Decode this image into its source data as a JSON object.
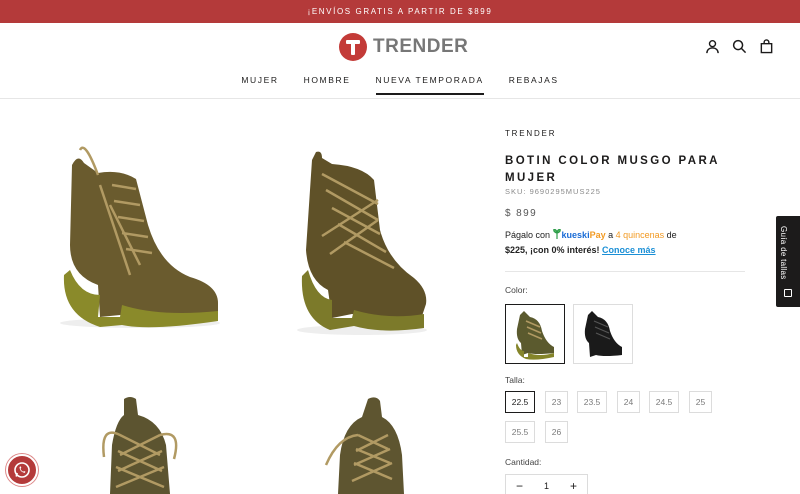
{
  "announcement": "¡ENVÍOS GRATIS A PARTIR DE $899",
  "brand_logo": {
    "text": "TRENDER",
    "color": "#c33b38"
  },
  "header_icons": [
    "account-icon",
    "search-icon",
    "cart-icon"
  ],
  "nav": {
    "items": [
      {
        "label": "MUJER"
      },
      {
        "label": "HOMBRE"
      },
      {
        "label": "NUEVA TEMPORADA"
      },
      {
        "label": "REBAJAS"
      }
    ],
    "active": "NUEVA TEMPORADA"
  },
  "product": {
    "brand": "TRENDER",
    "title": "BOTIN COLOR MUSGO PARA MUJER",
    "sku": "SKU: 9690295MUS225",
    "price": "$ 899",
    "kueski": {
      "prefix": "Págalo con ",
      "logo_a": "kueski",
      "logo_b": "Pay",
      "mid": " a ",
      "quincenas": "4 quincenas",
      "suffix_1": " de",
      "amount_line": "$225, ¡con 0% interés! ",
      "link": "Conoce más"
    },
    "color_label": "Color:",
    "colors": [
      {
        "name": "musgo",
        "hex": "#5b5a2e",
        "selected": true
      },
      {
        "name": "negro",
        "hex": "#1a1a1a",
        "selected": false
      }
    ],
    "size_label": "Talla:",
    "sizes": [
      "22.5",
      "23",
      "23.5",
      "24",
      "24.5",
      "25",
      "25.5",
      "26"
    ],
    "selected_size": "22.5",
    "quantity_label": "Cantidad:",
    "quantity": "1",
    "qty_minus": "−",
    "qty_plus": "+"
  },
  "size_guide": "Guía de tallas",
  "whatsapp": "whatsapp-icon"
}
